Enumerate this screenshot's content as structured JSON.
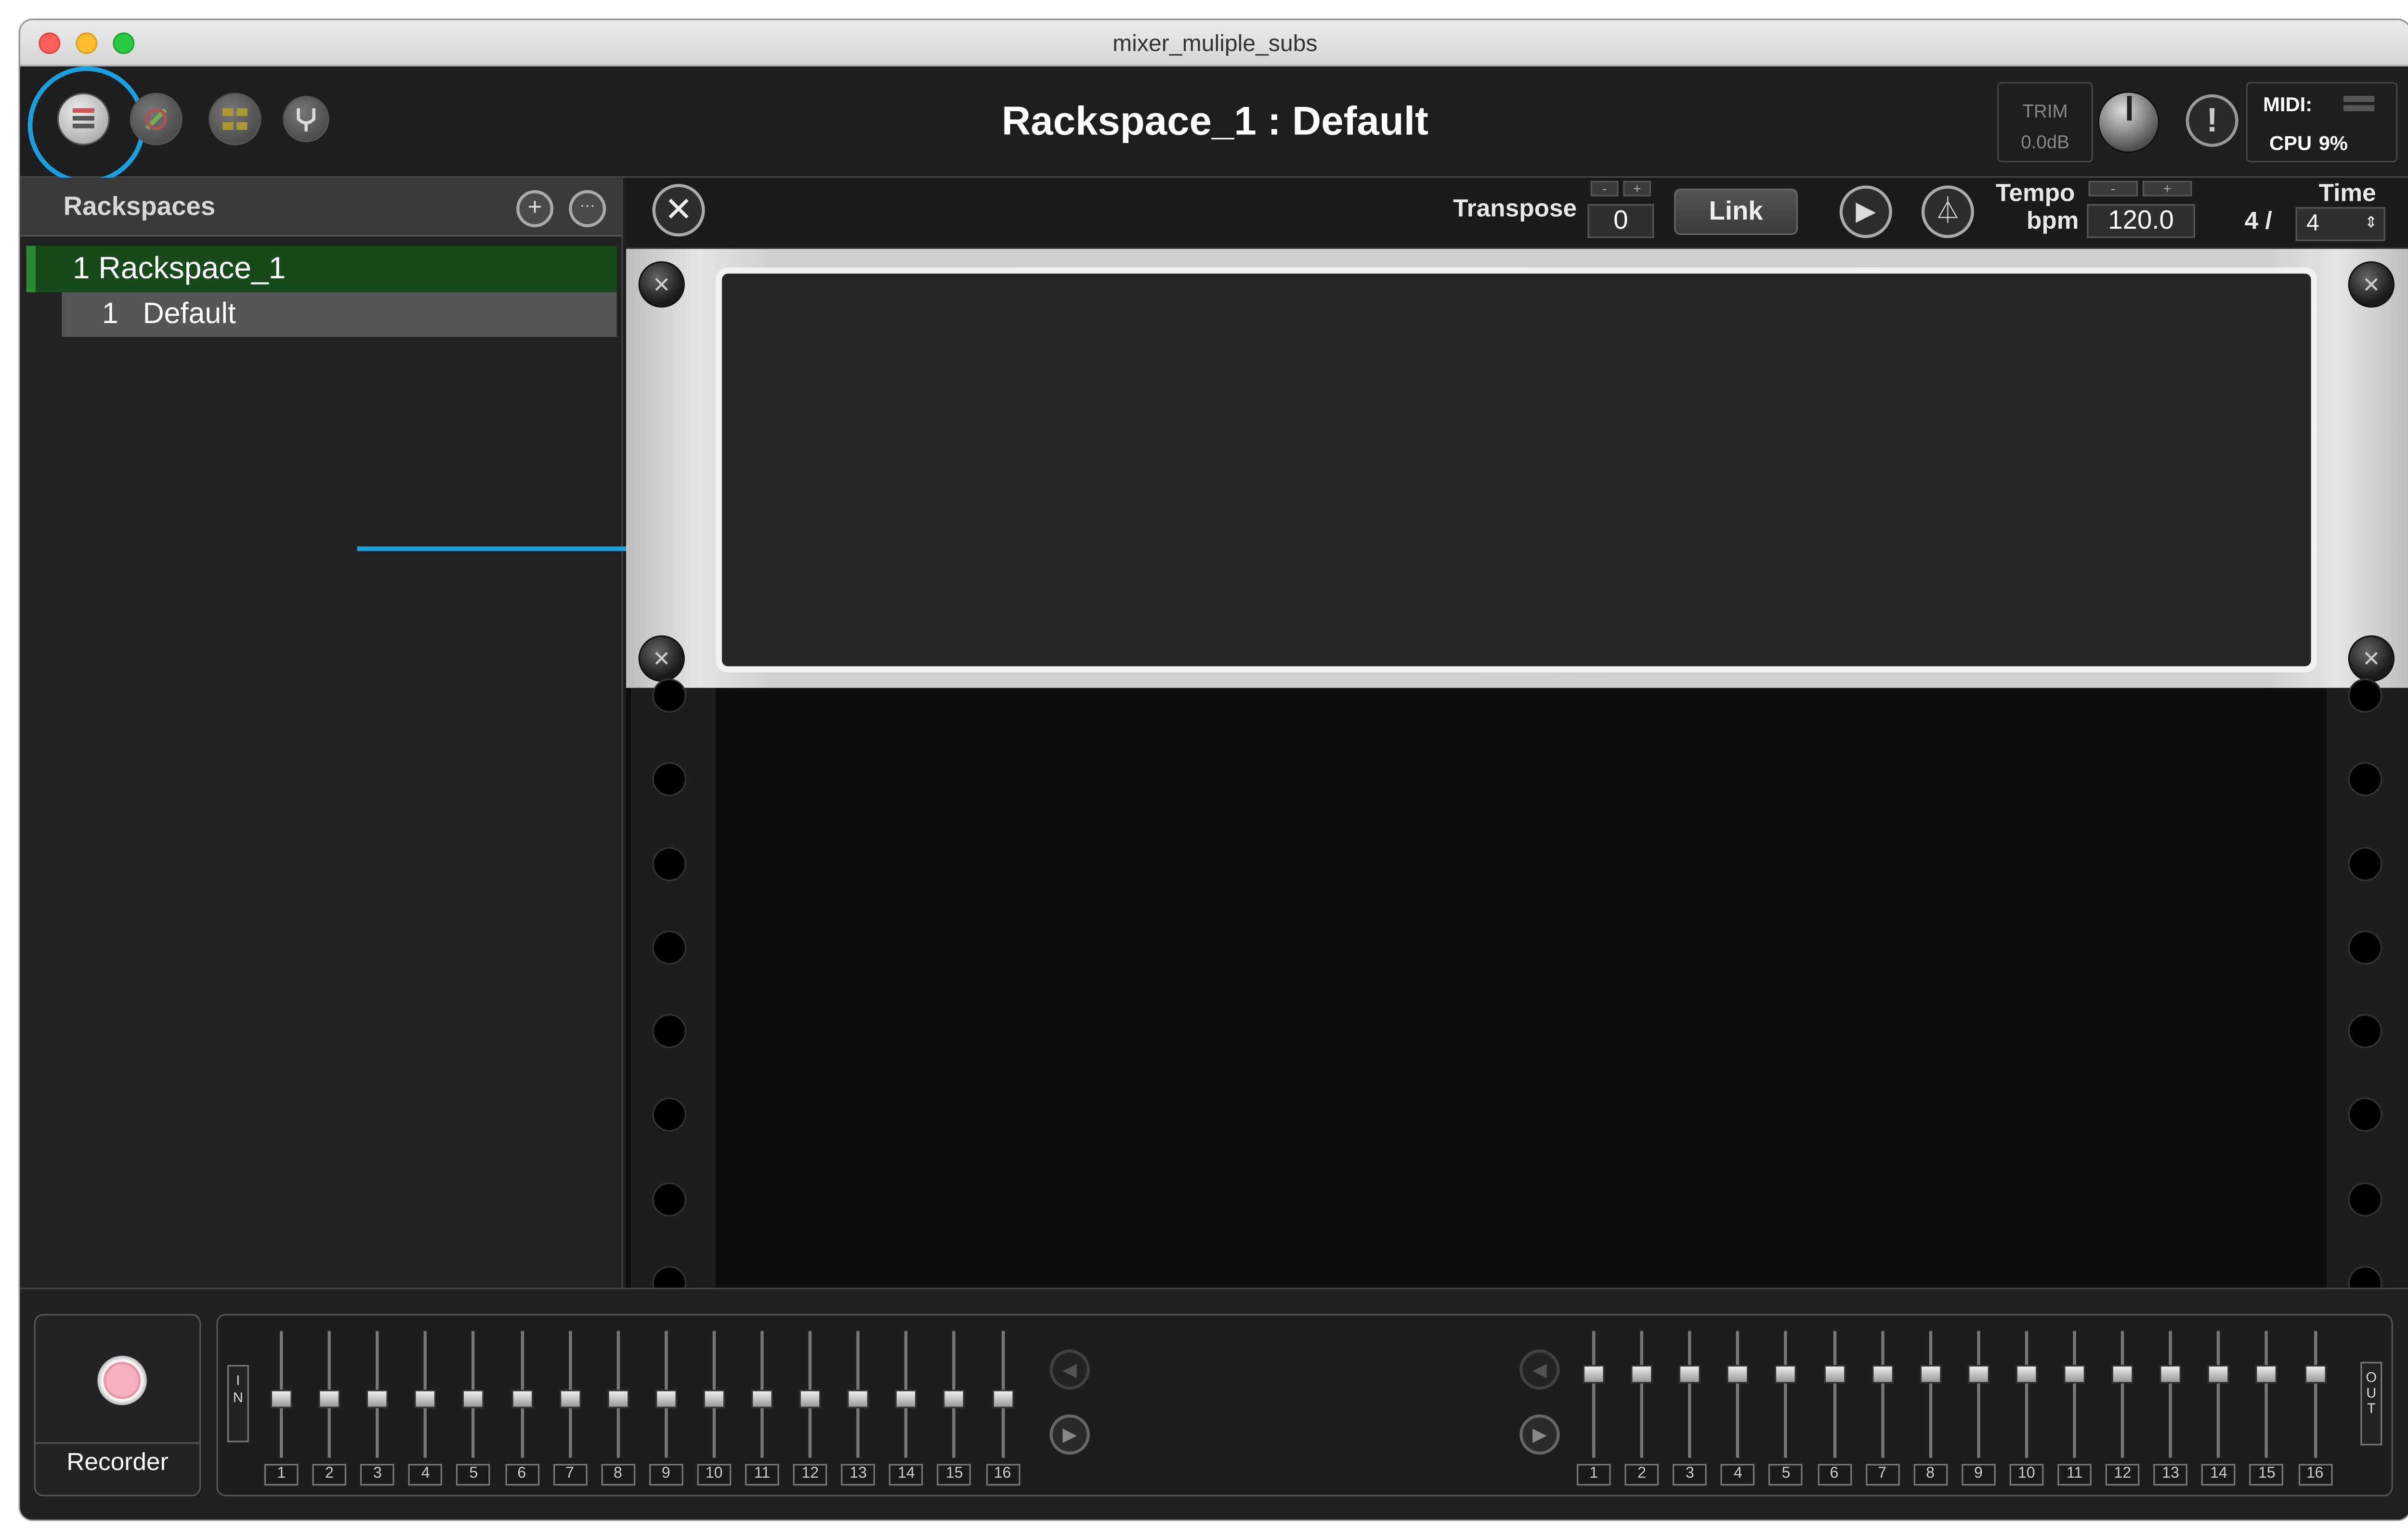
{
  "window": {
    "title": "mixer_muliple_subs"
  },
  "header": {
    "rackspace_title": "Rackspace_1 : Default",
    "trim_label": "TRIM",
    "trim_value": "0.0dB",
    "midi_label": "MIDI:",
    "cpu_label": "CPU",
    "cpu_value": "9%",
    "warning_glyph": "!"
  },
  "sidebar": {
    "title": "Rackspaces",
    "add_glyph": "+",
    "more_glyph": "···",
    "rackspaces": [
      {
        "label": "1 Rackspace_1",
        "variations": [
          {
            "label": "1   Default"
          }
        ]
      }
    ]
  },
  "toolbar": {
    "transpose_label": "Transpose",
    "transpose_value": "0",
    "link_label": "Link",
    "tempo_label": "Tempo",
    "bpm_label": "bpm",
    "tempo_value": "120.0",
    "time_label": "Time",
    "time_num": "4 /",
    "time_den": "4",
    "stepper_minus": "-",
    "stepper_plus": "+"
  },
  "recorder": {
    "label": "Recorder"
  },
  "mixer": {
    "in_label": "I\nN",
    "out_label": "O\nU\nT",
    "input_channels": [
      "1",
      "2",
      "3",
      "4",
      "5",
      "6",
      "7",
      "8",
      "9",
      "10",
      "11",
      "12",
      "13",
      "14",
      "15",
      "16"
    ],
    "output_channels": [
      "1",
      "2",
      "3",
      "4",
      "5",
      "6",
      "7",
      "8",
      "9",
      "10",
      "11",
      "12",
      "13",
      "14",
      "15",
      "16"
    ]
  },
  "colors": {
    "highlight": "#1aa0de",
    "selected_rackspace": "#184a1c",
    "record": "#f8b0bd"
  },
  "icons": [
    "rackspace-view-icon",
    "setlist-view-icon",
    "wiring-view-icon",
    "tuner-icon",
    "tools-icon",
    "play-icon",
    "metronome-icon",
    "screw-icon",
    "arrow-annotation"
  ]
}
